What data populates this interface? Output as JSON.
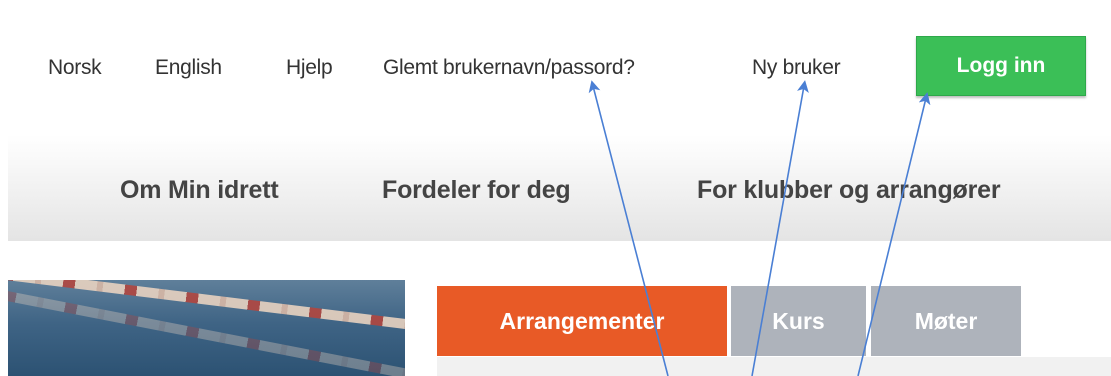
{
  "top_bar": {
    "links": {
      "norsk": "Norsk",
      "english": "English",
      "help": "Hjelp",
      "forgot": "Glemt brukernavn/passord?",
      "new_user": "Ny bruker"
    },
    "login_button": "Logg inn"
  },
  "main_nav": {
    "items": [
      "Om Min idrett",
      "Fordeler for deg",
      "For klubber og arrangører"
    ]
  },
  "tabs": [
    "Arrangementer",
    "Kurs",
    "Møter"
  ],
  "colors": {
    "login_green": "#3bbf57",
    "active_tab_orange": "#e85a26",
    "inactive_tab_grey": "#aeb3bb",
    "arrow_blue": "#4a7fd4"
  }
}
